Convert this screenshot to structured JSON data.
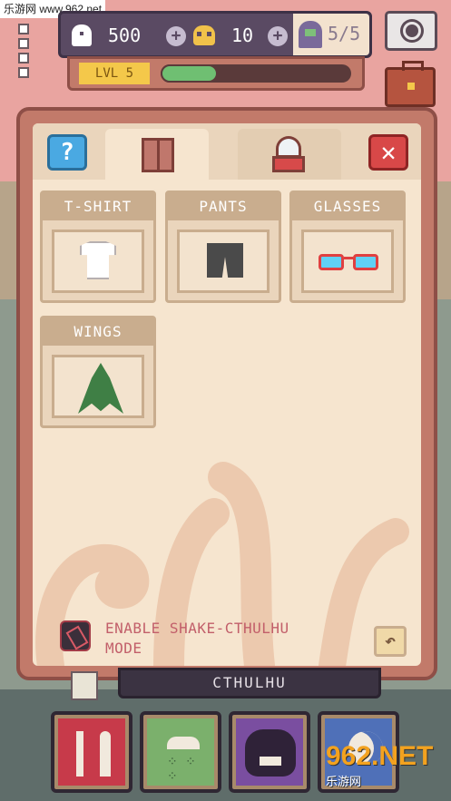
{
  "watermark": {
    "top_text": "乐游网 www.962.net",
    "logo_big": "962.NET",
    "logo_sub": "乐游网"
  },
  "hud": {
    "ghost_count": "500",
    "skull_count": "10",
    "cultists": "5/5",
    "level_label": "LVL 5",
    "xp_fraction": 0.3
  },
  "tabs": {
    "help": "?",
    "close": "✕"
  },
  "wardrobe": {
    "items": [
      {
        "label": "T-SHIRT"
      },
      {
        "label": "PANTS"
      },
      {
        "label": "GLASSES"
      },
      {
        "label": "WINGS"
      }
    ]
  },
  "shake": {
    "label": "ENABLE SHAKE-CTHULHU MODE"
  },
  "undo": {
    "label": "↶"
  },
  "name_plate": "CTHULHU",
  "colors": {
    "panel_bg": "#f6e5cf",
    "panel_border": "#c27a6a",
    "accent_red": "#d84848",
    "accent_blue": "#4aa9e2"
  },
  "icons": {
    "menu": "menu-icon",
    "ghost": "ghost-icon",
    "skull": "skull-icon",
    "cultist": "cultist-icon",
    "camera": "camera-icon",
    "briefcase": "briefcase-icon",
    "wardrobe": "wardrobe-icon",
    "gacha": "gacha-machine-icon",
    "food": "fork-knife-icon",
    "shower": "shower-icon",
    "play": "monster-face-icon",
    "sleep": "moon-icon"
  }
}
